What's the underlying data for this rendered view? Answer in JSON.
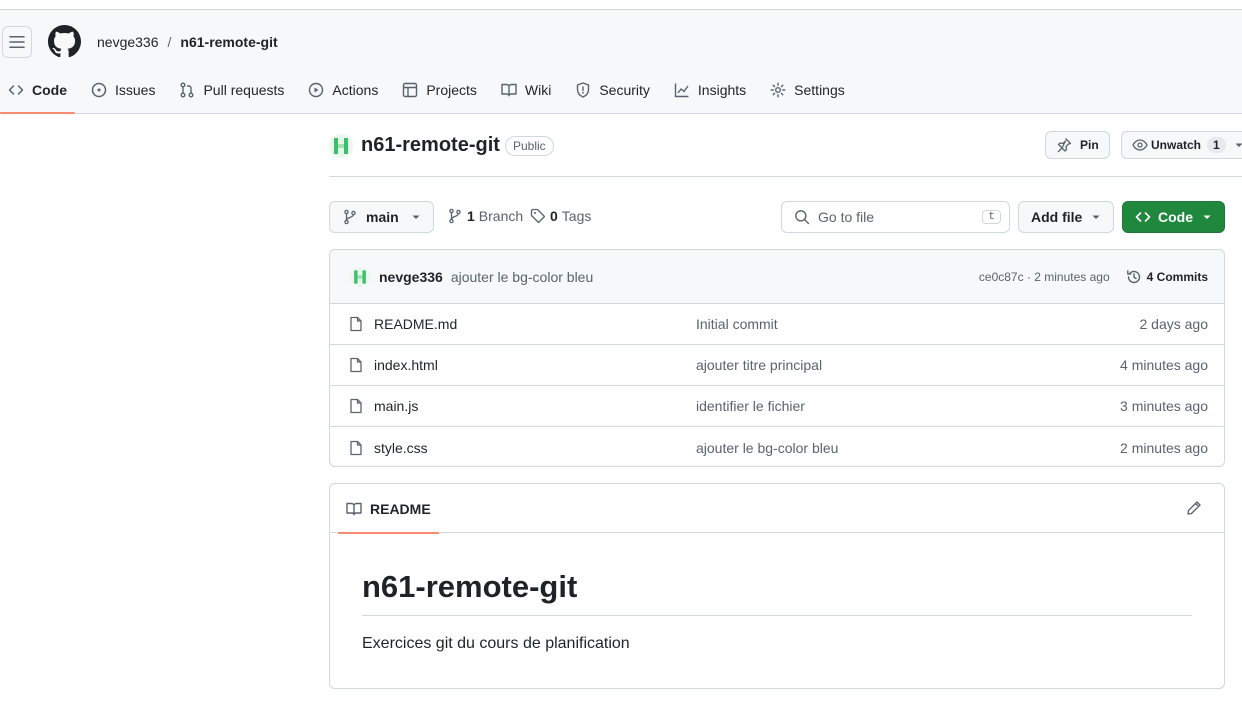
{
  "breadcrumb": {
    "owner": "nevge336",
    "separator": "/",
    "repo": "n61-remote-git"
  },
  "nav": {
    "tabs": [
      {
        "label": "Code",
        "icon": "code-icon",
        "selected": true
      },
      {
        "label": "Issues",
        "icon": "issue-icon"
      },
      {
        "label": "Pull requests",
        "icon": "pull-request-icon"
      },
      {
        "label": "Actions",
        "icon": "play-icon"
      },
      {
        "label": "Projects",
        "icon": "table-icon"
      },
      {
        "label": "Wiki",
        "icon": "book-icon"
      },
      {
        "label": "Security",
        "icon": "shield-icon"
      },
      {
        "label": "Insights",
        "icon": "graph-icon"
      },
      {
        "label": "Settings",
        "icon": "gear-icon"
      }
    ]
  },
  "repo": {
    "name": "n61-remote-git",
    "visibility": "Public",
    "pin_label": "Pin",
    "unwatch_label": "Unwatch",
    "watch_count": "1"
  },
  "branch_bar": {
    "branch": "main",
    "branches_count": "1",
    "branches_label": "Branch",
    "tags_count": "0",
    "tags_label": "Tags",
    "search_placeholder": "Go to file",
    "search_shortcut": "t",
    "add_file_label": "Add file",
    "code_label": "Code"
  },
  "latest_commit": {
    "author": "nevge336",
    "message": "ajouter le bg-color bleu",
    "info": "ce0c87c · 2 minutes ago",
    "commits_label": "4 Commits"
  },
  "files": [
    {
      "name": "README.md",
      "message": "Initial commit",
      "date": "2 days ago"
    },
    {
      "name": "index.html",
      "message": "ajouter titre principal",
      "date": "4 minutes ago"
    },
    {
      "name": "main.js",
      "message": "identifier le fichier",
      "date": "3 minutes ago"
    },
    {
      "name": "style.css",
      "message": "ajouter le bg-color bleu",
      "date": "2 minutes ago"
    }
  ],
  "readme": {
    "tab_label": "README",
    "heading": "n61-remote-git",
    "paragraph": "Exercices git du cours de planification"
  },
  "colors": {
    "accent_underline": "#fd8c73",
    "code_button": "#1f883d",
    "border": "#d0d7de",
    "muted_text": "#59636e"
  }
}
